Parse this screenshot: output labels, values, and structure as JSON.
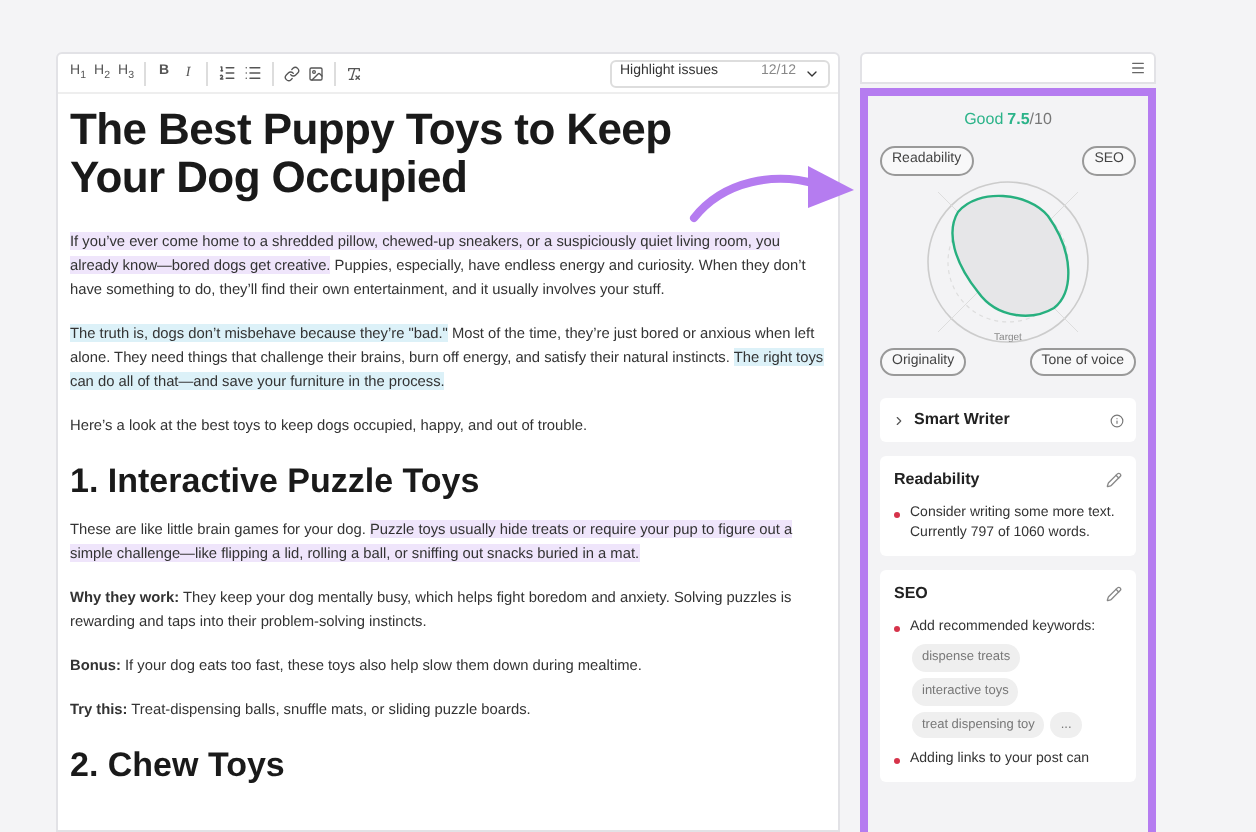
{
  "toolbar": {
    "buttons": [
      {
        "kind": "text",
        "label": "H$_{1}$"
      },
      {
        "kind": "text",
        "label": "H$_{2}$"
      },
      {
        "kind": "text",
        "label": "H$_{3}$"
      },
      {
        "kind": "sep"
      },
      {
        "kind": "bold",
        "label": "B"
      },
      {
        "kind": "italic",
        "label": "I"
      },
      {
        "kind": "sep"
      },
      {
        "kind": "ordered-list"
      },
      {
        "kind": "bullet-list"
      },
      {
        "kind": "sep"
      },
      {
        "kind": "link"
      },
      {
        "kind": "image"
      },
      {
        "kind": "sep"
      },
      {
        "kind": "clear-format"
      }
    ],
    "highlight": {
      "label": "Highlight issues",
      "count": "12/12"
    }
  },
  "article": {
    "title": "The Best Puppy Toys to Keep Your Dog Occupied",
    "blocks": [
      {
        "kind": "p",
        "segments": [
          {
            "text": "If you’ve ever come home to a shredded pillow, chewed-up sneakers, or a suspiciously quiet living room, you already know—bored dogs get creative.",
            "highlighted": true,
            "color": "#efe5fb"
          },
          {
            "text": " Puppies, especially, have endless energy and curiosity. When they don’t have something to do, they’ll find their own entertainment, and it usually involves your stuff.",
            "highlighted": false
          }
        ]
      },
      {
        "kind": "p",
        "segments": [
          {
            "text": "The truth is, dogs don’t misbehave because they’re \"bad.\"",
            "highlighted": true,
            "color": "#dcf1f8"
          },
          {
            "text": " Most of the time, they’re just bored or anxious when left alone. They need things that challenge their brains, burn off energy, and satisfy their natural instincts. ",
            "highlighted": false
          },
          {
            "text": "The right toys can do all of that—and save your furniture in the process.",
            "highlighted": true,
            "color": "#dcf1f8"
          }
        ]
      },
      {
        "kind": "p",
        "segments": [
          {
            "text": "Here’s a look at the best toys to keep dogs occupied, happy, and out of trouble.",
            "highlighted": false
          }
        ]
      },
      {
        "kind": "h2",
        "text": "1. Interactive Puzzle Toys"
      },
      {
        "kind": "p",
        "segments": [
          {
            "text": "These are like little brain games for your dog. ",
            "highlighted": false
          },
          {
            "text": "Puzzle toys usually hide treats or require your pup to figure out a simple challenge—like flipping a lid, rolling a ball, or sniffing out snacks buried in a mat.",
            "highlighted": true,
            "color": "#efe5fb"
          }
        ]
      },
      {
        "kind": "p",
        "segments": [
          {
            "text": "**Why they work:** They keep your dog mentally busy, which helps fight boredom and anxiety. Solving puzzles is rewarding and taps into their problem-solving instincts.",
            "highlighted": false
          }
        ]
      },
      {
        "kind": "p",
        "segments": [
          {
            "text": "**Bonus:** If your dog eats too fast, these toys also help slow them down during mealtime.",
            "highlighted": false
          }
        ]
      },
      {
        "kind": "p",
        "segments": [
          {
            "text": "**Try this:** Treat-dispensing balls, snuffle mats, or sliding puzzle boards.",
            "highlighted": false
          }
        ]
      },
      {
        "kind": "h2",
        "text": "2. Chew Toys"
      }
    ]
  },
  "sidebar": {
    "score": {
      "label": "Good",
      "value": "7.5",
      "max": "/10"
    },
    "radar_labels": [
      "Readability",
      "SEO",
      "Originality",
      "Tone of voice"
    ],
    "target_label": "Target",
    "smart_writer": {
      "label": "Smart Writer",
      "expanded": false
    },
    "cards": [
      {
        "title": "Readability",
        "items": [
          {
            "text": "Consider writing some more text. Currently 797 of 1060 words."
          }
        ]
      },
      {
        "title": "SEO",
        "items": [
          {
            "text": "Add recommended keywords:",
            "keywords": [
              "dispense treats",
              "interactive toys",
              "treat dispensing toy"
            ],
            "more": "..."
          },
          {
            "text": "Adding links to your post can"
          }
        ]
      }
    ]
  }
}
